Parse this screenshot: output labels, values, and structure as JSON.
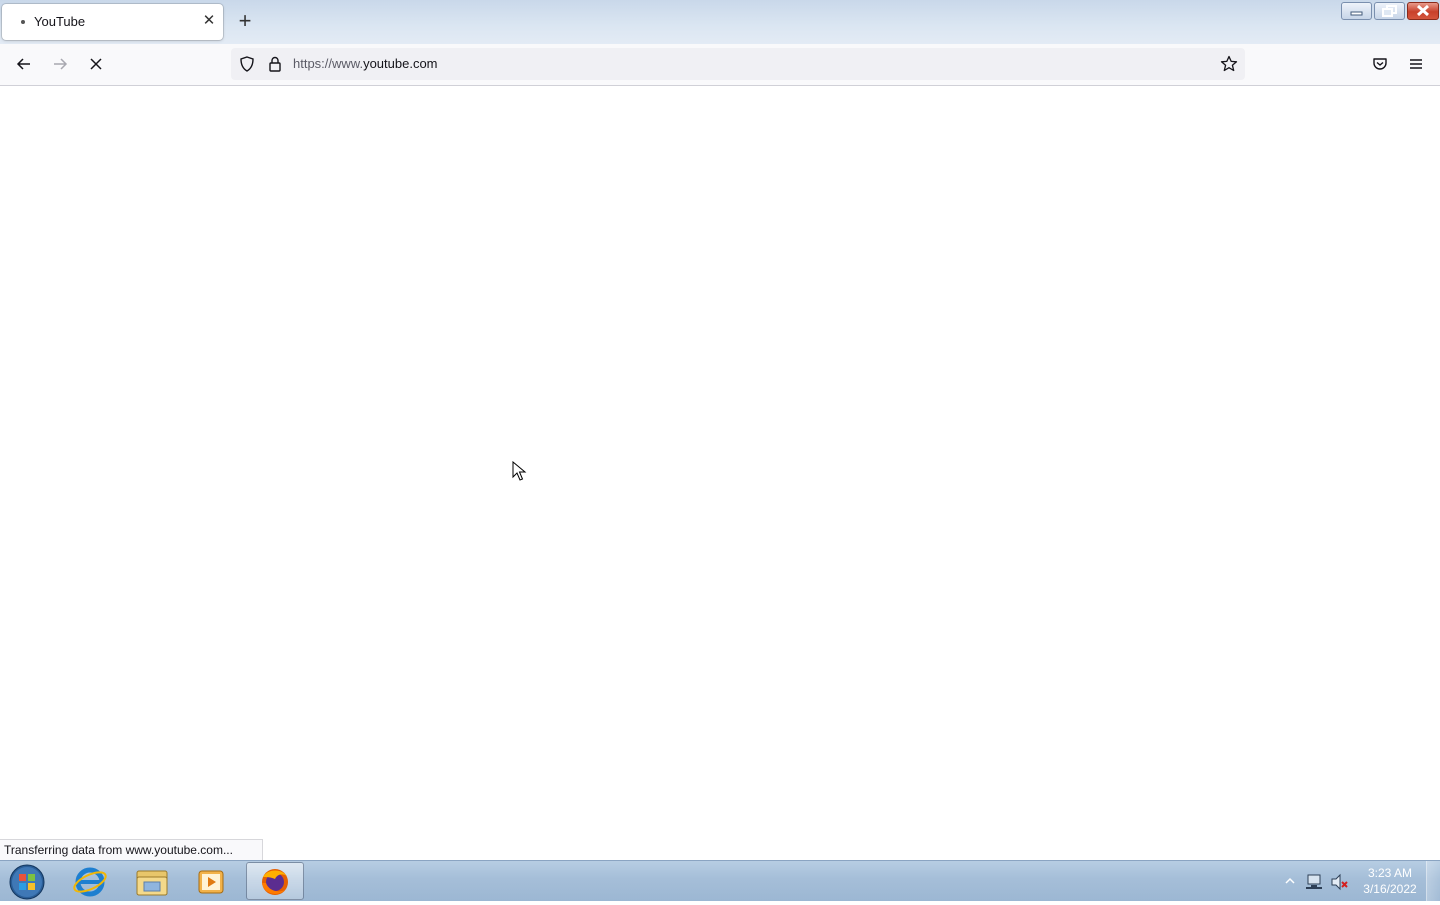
{
  "browser": {
    "tab": {
      "title": "YouTube",
      "close_symbol": "✕"
    },
    "new_tab_symbol": "+",
    "url": {
      "scheme_prefix": "https://www.",
      "domain": "youtube.com"
    },
    "status_text": "Transferring data from www.youtube.com..."
  },
  "taskbar": {
    "clock": {
      "time": "3:23 AM",
      "date": "3/16/2022"
    },
    "pinned_items": [
      "start-orb",
      "internet-explorer-icon",
      "file-explorer-icon",
      "media-player-icon",
      "firefox-icon"
    ]
  },
  "colors": {
    "accent_red_close": "#c8412b",
    "taskbar": "#a5bed8"
  }
}
